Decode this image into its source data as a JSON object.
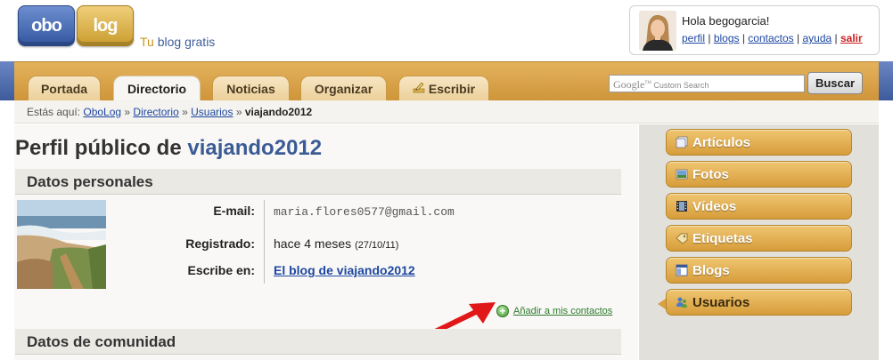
{
  "brand": {
    "logo_left": "obo",
    "logo_right": "log",
    "tagline_tu": "Tu",
    "tagline_rest": " blog gratis"
  },
  "user": {
    "greeting": "Hola ",
    "username": "begogarcia",
    "greeting_end": "!",
    "links": {
      "perfil": "perfil",
      "blogs": "blogs",
      "contactos": "contactos",
      "ayuda": "ayuda",
      "salir": "salir"
    },
    "separator": " | "
  },
  "nav": {
    "tabs": [
      {
        "label": "Portada"
      },
      {
        "label": "Directorio"
      },
      {
        "label": "Noticias"
      },
      {
        "label": "Organizar"
      },
      {
        "label": "Escribir"
      }
    ],
    "active_tab": "Directorio"
  },
  "search": {
    "google_label": "Google",
    "tm": "TM",
    "placeholder": "Custom Search",
    "button": "Buscar"
  },
  "breadcrumb": {
    "prefix": "Estás aquí: ",
    "items": [
      "OboLog",
      "Directorio",
      "Usuarios"
    ],
    "separator": " » ",
    "current": "viajando2012"
  },
  "profile": {
    "title_prefix": "Perfil público de ",
    "title_user": "viajando2012",
    "section_personal": "Datos personales",
    "email_label": "E-mail:",
    "email_value": "maria.flores0577@gmail.com",
    "registered_label": "Registrado:",
    "registered_value": "hace 4 meses ",
    "registered_date": "(27/10/11)",
    "writes_label": "Escribe en:",
    "writes_value": "El blog de viajando2012",
    "add_contact": "Añadir a mis contactos",
    "section_community": "Datos de comunidad"
  },
  "sidebar": {
    "items": [
      {
        "label": "Artículos",
        "icon": "articles-icon"
      },
      {
        "label": "Fotos",
        "icon": "photos-icon"
      },
      {
        "label": "Vídeos",
        "icon": "film-icon"
      },
      {
        "label": "Etiquetas",
        "icon": "tag-icon"
      },
      {
        "label": "Blogs",
        "icon": "blog-icon"
      },
      {
        "label": "Usuarios",
        "icon": "users-icon"
      }
    ],
    "active": "Usuarios"
  },
  "colors": {
    "accent_orange": "#d79d3a",
    "link_blue": "#1e47a0",
    "title_blue": "#3b5b95",
    "logout_red": "#cc1f1f",
    "add_green": "#2c7a2c"
  }
}
